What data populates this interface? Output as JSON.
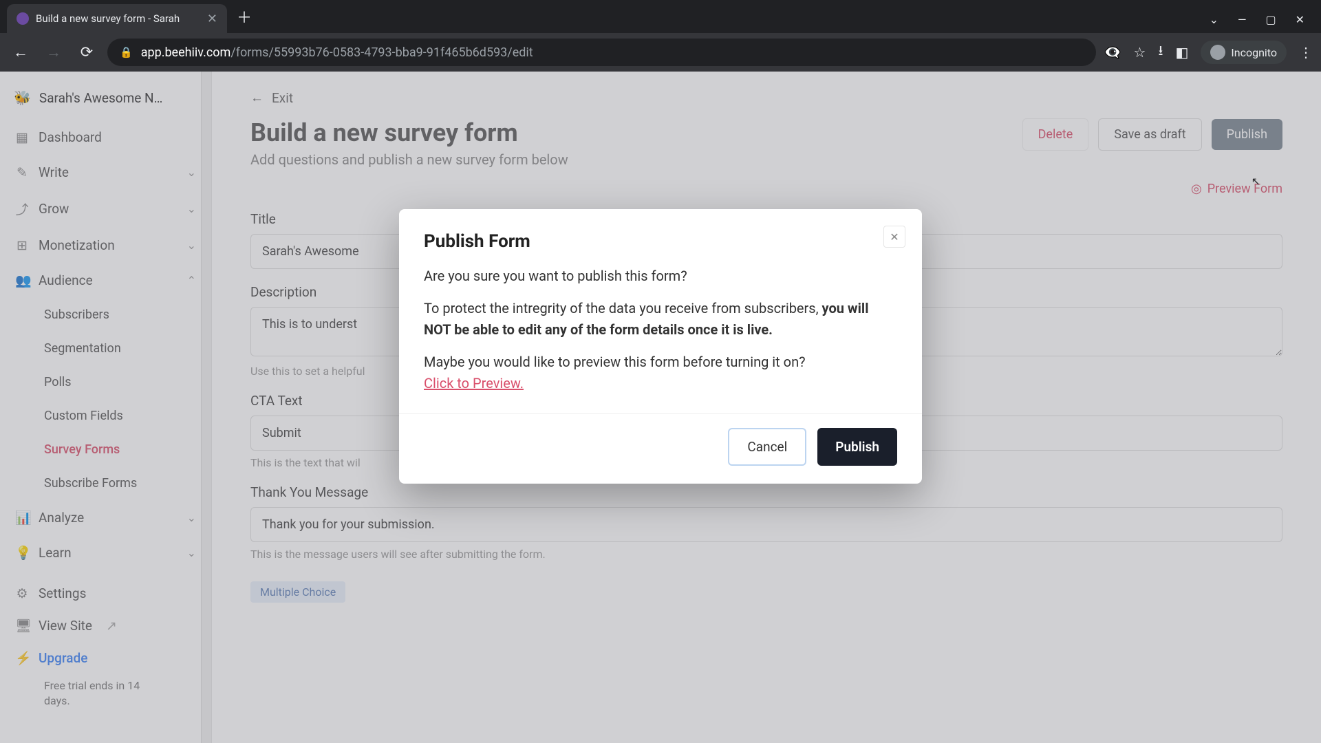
{
  "browser": {
    "tab_title": "Build a new survey form - Sarah",
    "url_domain": "app.beehiiv.com",
    "url_path": "/forms/55993b76-0583-4793-bba9-91f465b6d593/edit",
    "incognito_label": "Incognito"
  },
  "sidebar": {
    "workspace": "Sarah's Awesome N…",
    "items": [
      {
        "label": "Dashboard",
        "icon": "▦"
      },
      {
        "label": "Write",
        "icon": "✎",
        "chev": true
      },
      {
        "label": "Grow",
        "icon": "⤴",
        "chev": true
      },
      {
        "label": "Monetization",
        "icon": "⊞",
        "chev": true
      },
      {
        "label": "Audience",
        "icon": "👥",
        "chev": true,
        "expanded": true
      }
    ],
    "audience_sub": [
      "Subscribers",
      "Segmentation",
      "Polls",
      "Custom Fields",
      "Survey Forms",
      "Subscribe Forms"
    ],
    "audience_active_index": 4,
    "analyze": {
      "label": "Analyze",
      "icon": "📊"
    },
    "learn": {
      "label": "Learn",
      "icon": "💡"
    },
    "settings": {
      "label": "Settings",
      "icon": "⚙"
    },
    "viewsite": {
      "label": "View Site",
      "icon": "🖥",
      "ext": "↗"
    },
    "upgrade": {
      "label": "Upgrade",
      "icon": "⚡"
    },
    "trial": "Free trial ends in 14 days."
  },
  "main": {
    "exit": "Exit",
    "title": "Build a new survey form",
    "subtitle": "Add questions and publish a new survey form below",
    "actions": {
      "delete": "Delete",
      "draft": "Save as draft",
      "publish": "Publish"
    },
    "preview": "Preview Form",
    "fields": {
      "title_label": "Title",
      "title_value": "Sarah's Awesome",
      "desc_label": "Description",
      "desc_value": "This is to underst",
      "desc_help": "Use this to set a helpful",
      "cta_label": "CTA Text",
      "cta_value": "Submit",
      "cta_help": "This is the text that wil",
      "thank_label": "Thank You Message",
      "thank_value": "Thank you for your submission.",
      "thank_help": "This is the message users will see after submitting the form.",
      "chip": "Multiple Choice"
    }
  },
  "modal": {
    "title": "Publish Form",
    "q": "Are you sure you want to publish this form?",
    "p1a": "To protect the intregrity of the data you receive from subscribers, ",
    "p1b": "you will NOT be able to edit any of the form details once it is live.",
    "p2": "Maybe you would like to preview this form before turning it on?",
    "link": "Click to Preview.",
    "cancel": "Cancel",
    "publish": "Publish"
  }
}
